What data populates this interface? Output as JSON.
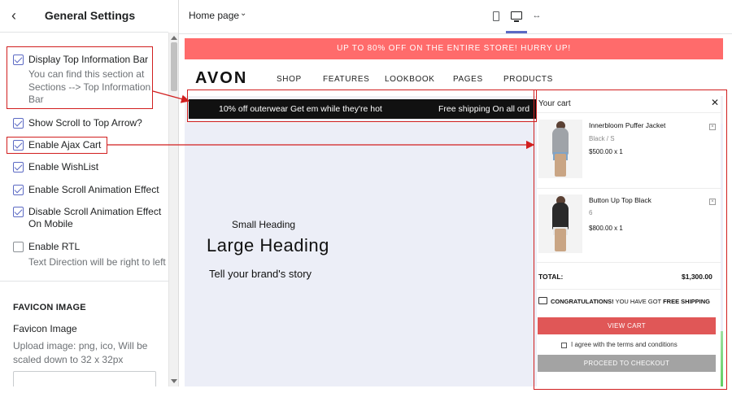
{
  "sidebar": {
    "title": "General Settings",
    "settings": [
      {
        "label": "Display Top Information Bar",
        "checked": true,
        "help": "You can find this section at Sections --> Top Information Bar"
      },
      {
        "label": "Show Scroll to Top Arrow?",
        "checked": true
      },
      {
        "label": "Enable Ajax Cart",
        "checked": true
      },
      {
        "label": "Enable WishList",
        "checked": true
      },
      {
        "label": "Enable Scroll Animation Effect",
        "checked": true
      },
      {
        "label": "Disable Scroll Animation Effect On Mobile",
        "checked": true
      },
      {
        "label": "Enable RTL",
        "checked": false,
        "help": "Text Direction will be right to left"
      }
    ],
    "favicon": {
      "heading": "FAVICON IMAGE",
      "label": "Favicon Image",
      "help": "Upload image: png, ico, Will be scaled down to 32 x 32px"
    }
  },
  "toolbar": {
    "page_select": "Home page",
    "active_device": "desktop"
  },
  "store": {
    "promo": "UP TO 80% OFF ON THE ENTIRE STORE! HURRY UP!",
    "brand": "AVON",
    "nav": [
      "SHOP",
      "FEATURES",
      "LOOKBOOK",
      "PAGES",
      "PRODUCTS"
    ],
    "announcements": [
      "10% off outerwear Get em while they're hot",
      "Free shipping On all ord"
    ],
    "hero": {
      "small_heading": "Small Heading",
      "large_heading": "Large Heading",
      "story": "Tell your brand's story"
    }
  },
  "cart": {
    "title": "Your cart",
    "items": [
      {
        "name": "Innerbloom Puffer Jacket",
        "variant": "Black / S",
        "price": "$500.00 x 1"
      },
      {
        "name": "Button Up Top Black",
        "variant": "6",
        "price": "$800.00 x 1"
      }
    ],
    "total_label": "TOTAL:",
    "total_value": "$1,300.00",
    "shipping_msg": {
      "strong1": "CONGRATULATIONS!",
      "middle": " YOU HAVE GOT ",
      "strong2": "FREE SHIPPING"
    },
    "view_cart": "VIEW CART",
    "agree": "I agree with the terms and conditions",
    "checkout": "PROCEED TO CHECKOUT"
  },
  "colors": {
    "accent": "#5c6ac4",
    "promo_bar": "#ff6b6b",
    "callout": "#d11f1f",
    "view_cart": "#e05757",
    "checkout": "#a3a3a3"
  }
}
